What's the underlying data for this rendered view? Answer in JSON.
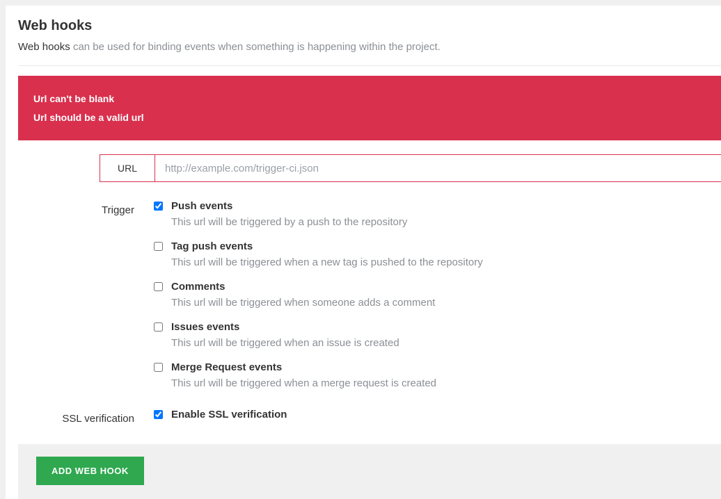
{
  "header": {
    "title": "Web hooks",
    "desc_lead": "Web hooks ",
    "desc_rest": "can be used for binding events when something is happening within the project."
  },
  "alert": {
    "lines": [
      "Url can't be blank",
      "Url should be a valid url"
    ]
  },
  "form": {
    "url": {
      "label": "URL",
      "placeholder": "http://example.com/trigger-ci.json",
      "value": ""
    },
    "trigger": {
      "label": "Trigger",
      "items": [
        {
          "title": "Push events",
          "desc": "This url will be triggered by a push to the repository",
          "checked": true
        },
        {
          "title": "Tag push events",
          "desc": "This url will be triggered when a new tag is pushed to the repository",
          "checked": false
        },
        {
          "title": "Comments",
          "desc": "This url will be triggered when someone adds a comment",
          "checked": false
        },
        {
          "title": "Issues events",
          "desc": "This url will be triggered when an issue is created",
          "checked": false
        },
        {
          "title": "Merge Request events",
          "desc": "This url will be triggered when a merge request is created",
          "checked": false
        }
      ]
    },
    "ssl": {
      "label": "SSL verification",
      "title": "Enable SSL verification",
      "checked": true
    },
    "submit_label": "ADD WEB HOOK"
  }
}
